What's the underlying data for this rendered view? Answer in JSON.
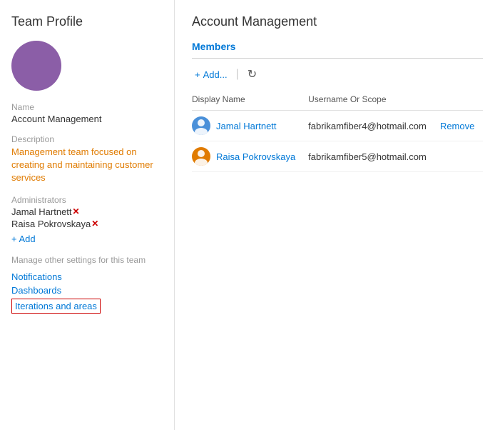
{
  "sidebar": {
    "title": "Team Profile",
    "fields": {
      "name_label": "Name",
      "name_value": "Account Management",
      "description_label": "Description",
      "description_value": "Management team focused on creating and maintaining customer services",
      "administrators_label": "Administrators",
      "admins": [
        {
          "name": "Jamal Hartnett"
        },
        {
          "name": "Raisa Pokrovskaya"
        }
      ],
      "add_label": "+ Add",
      "manage_label": "Manage other settings for this team",
      "links": [
        {
          "id": "notifications",
          "label": "Notifications",
          "highlighted": false
        },
        {
          "id": "dashboards",
          "label": "Dashboards",
          "highlighted": false
        },
        {
          "id": "iterations-areas",
          "label": "Iterations and areas",
          "highlighted": true
        }
      ]
    }
  },
  "main": {
    "title": "Account Management",
    "section_label": "Members",
    "toolbar": {
      "add_label": "+ Add...",
      "refresh_icon": "↻"
    },
    "table": {
      "columns": [
        "Display Name",
        "Username Or Scope",
        ""
      ],
      "rows": [
        {
          "display_name": "Jamal Hartnett",
          "username": "fabrikamfiber4@hotmail.com",
          "remove": "Remove",
          "avatar_color": "blue"
        },
        {
          "display_name": "Raisa Pokrovskaya",
          "username": "fabrikamfiber5@hotmail.com",
          "remove": "",
          "avatar_color": "orange"
        }
      ]
    }
  }
}
